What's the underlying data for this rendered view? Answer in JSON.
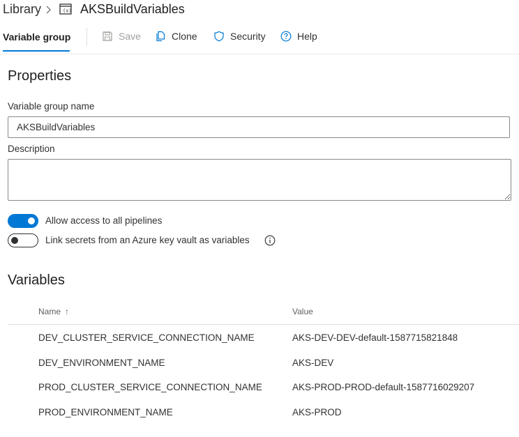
{
  "breadcrumb": {
    "root": "Library",
    "current": "AKSBuildVariables"
  },
  "toolbar": {
    "active_tab": "Variable group",
    "save_label": "Save",
    "clone_label": "Clone",
    "security_label": "Security",
    "help_label": "Help"
  },
  "properties": {
    "heading": "Properties",
    "name_label": "Variable group name",
    "name_value": "AKSBuildVariables",
    "description_label": "Description",
    "description_value": ""
  },
  "toggles": {
    "allow_access": {
      "label": "Allow access to all pipelines",
      "on": true
    },
    "link_secrets": {
      "label": "Link secrets from an Azure key vault as variables",
      "on": false
    }
  },
  "variables": {
    "heading": "Variables",
    "columns": {
      "name": "Name",
      "value": "Value"
    },
    "sort_indicator": "↑",
    "rows": [
      {
        "name": "DEV_CLUSTER_SERVICE_CONNECTION_NAME",
        "value": "AKS-DEV-DEV-default-1587715821848"
      },
      {
        "name": "DEV_ENVIRONMENT_NAME",
        "value": "AKS-DEV"
      },
      {
        "name": "PROD_CLUSTER_SERVICE_CONNECTION_NAME",
        "value": "AKS-PROD-PROD-default-1587716029207"
      },
      {
        "name": "PROD_ENVIRONMENT_NAME",
        "value": "AKS-PROD"
      }
    ]
  },
  "colors": {
    "accent": "#0078d4",
    "disabled": "#a19f9d",
    "text": "#323130"
  }
}
